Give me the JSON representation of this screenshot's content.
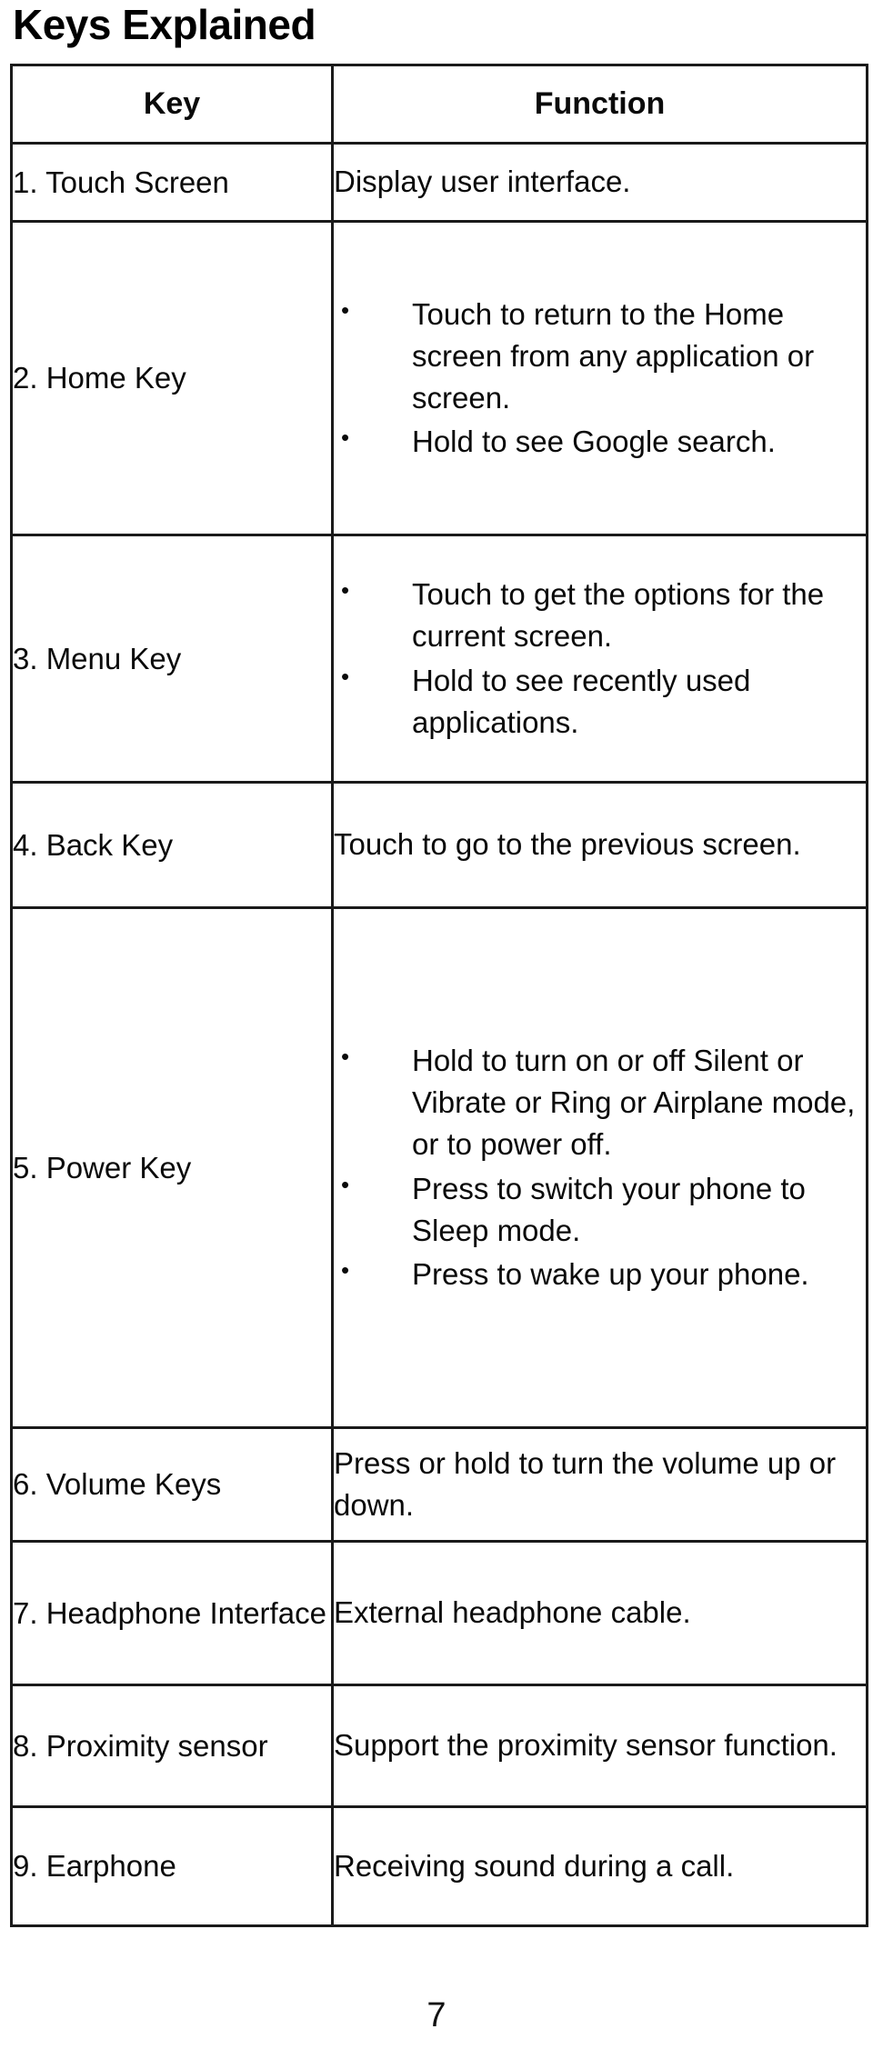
{
  "document": {
    "title": "Keys Explained",
    "page_number": "7"
  },
  "table": {
    "headers": {
      "key": "Key",
      "function": "Function"
    },
    "rows": [
      {
        "key": "1. Touch Screen",
        "function_type": "plain",
        "function_text": "Display user interface.",
        "bullets": []
      },
      {
        "key": "2. Home Key",
        "function_type": "bullets",
        "function_text": "",
        "bullets": [
          "Touch to return to the Home screen from any application or screen.",
          "Hold to see Google search."
        ]
      },
      {
        "key": "3. Menu Key",
        "function_type": "bullets",
        "function_text": "",
        "bullets": [
          "Touch to get the options for the current screen.",
          "Hold to see recently used applications."
        ]
      },
      {
        "key": "4. Back Key",
        "function_type": "plain",
        "function_text": "Touch to go to the previous screen.",
        "bullets": []
      },
      {
        "key": "5. Power Key",
        "function_type": "bullets",
        "function_text": "",
        "bullets": [
          "Hold to turn on or off Silent or Vibrate or Ring or Airplane mode, or to power off.",
          "Press to switch your phone to Sleep mode.",
          "Press to wake up your phone."
        ]
      },
      {
        "key": "6. Volume Keys",
        "function_type": "plain",
        "function_text": "Press or hold to turn the volume up or down.",
        "bullets": []
      },
      {
        "key": "7. Headphone Interface",
        "function_type": "plain",
        "function_text": "External headphone cable.",
        "bullets": []
      },
      {
        "key": "8. Proximity sensor",
        "function_type": "plain",
        "function_text": "Support the proximity sensor function.",
        "bullets": []
      },
      {
        "key": "9. Earphone",
        "function_type": "plain",
        "function_text": "Receiving sound during a call.",
        "bullets": []
      }
    ]
  }
}
